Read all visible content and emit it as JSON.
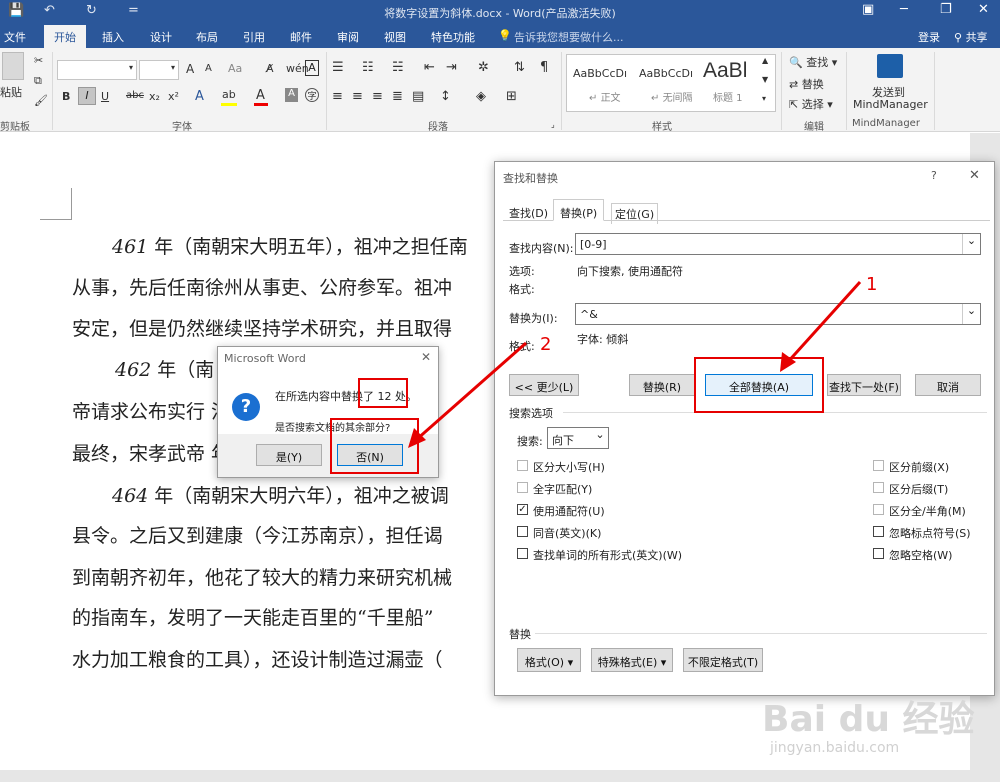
{
  "window": {
    "title": "将数字设置为斜体.docx - Word(产品激活失败)",
    "minimize": "─",
    "restore": "❐",
    "close": "✕",
    "ribbon_opts": "▣"
  },
  "quick_access": {
    "save": "💾",
    "undo": "↶",
    "redo": "↻",
    "customize": "="
  },
  "tabs": [
    "文件",
    "开始",
    "插入",
    "设计",
    "布局",
    "引用",
    "邮件",
    "审阅",
    "视图",
    "特色功能"
  ],
  "active_tab": "开始",
  "tell_me": "告诉我您想要做什么...",
  "signin": "登录",
  "share": "共享",
  "ribbon": {
    "clipboard": {
      "paste": "粘贴",
      "label": "剪贴板"
    },
    "font": {
      "label": "字体",
      "size_up": "A",
      "size_down": "A",
      "clear": "Aa",
      "bold": "B",
      "italic": "I",
      "underline": "U",
      "strike": "abc",
      "sub": "x₂",
      "sup": "x²"
    },
    "paragraph": {
      "label": "段落"
    },
    "styles": {
      "label": "样式",
      "items": [
        {
          "preview": "AaBbCcDı",
          "name": "正文"
        },
        {
          "preview": "AaBbCcDı",
          "name": "无间隔"
        },
        {
          "preview": "AaBl",
          "name": "标题 1"
        }
      ]
    },
    "editing": {
      "label": "编辑",
      "find": "查找",
      "replace": "替换",
      "select": "选择"
    },
    "mindmanager": {
      "send": "发送到",
      "name": "MindManager",
      "label": "MindManager"
    }
  },
  "document": {
    "paragraphs": [
      {
        "year": "461",
        "text": " 年（南朝宋大明五年），祖冲之担任南"
      },
      {
        "text": "从事，先后任南徐州从事吏、公府参军。祖冲"
      },
      {
        "text": "安定，但是仍然继续坚持学术研究，并且取得"
      },
      {
        "year": "462",
        "text": " 年（南                              之把精"
      },
      {
        "text": "帝请求公布实行                              法的官"
      },
      {
        "text": "最终，宋孝武帝                              年）改"
      },
      {
        "year": "464",
        "text": " 年（南朝宋大明六年），祖冲之被调"
      },
      {
        "text": "县令。之后又到建康（今江苏南京），担任谒"
      },
      {
        "text": "到南朝齐初年，他花了较大的精力来研究机械"
      },
      {
        "text": "的指南车，发明了一天能走百里的“千里船”"
      },
      {
        "text": "水力加工粮食的工具），还设计制造过漏壶（"
      }
    ]
  },
  "find_replace": {
    "title": "查找和替换",
    "help": "?",
    "close": "✕",
    "tabs": [
      "查找(D)",
      "替换(P)",
      "定位(G)"
    ],
    "find_label": "查找内容(N):",
    "find_value": "[0-9]",
    "options_label": "选项:",
    "options_value": "向下搜索, 使用通配符",
    "format_label": "格式:",
    "replace_label": "替换为(I):",
    "replace_value": "^&",
    "replace_format_label": "格式:",
    "replace_format_value": "字体: 倾斜",
    "buttons": {
      "less": "<< 更少(L)",
      "replace": "替换(R)",
      "replace_all": "全部替换(A)",
      "find_next": "查找下一处(F)",
      "cancel": "取消"
    },
    "search_options_label": "搜索选项",
    "search_label": "搜索:",
    "search_value": "向下",
    "left_options": [
      {
        "label": "区分大小写(H)",
        "checked": false,
        "disabled": true
      },
      {
        "label": "全字匹配(Y)",
        "checked": false,
        "disabled": true
      },
      {
        "label": "使用通配符(U)",
        "checked": true,
        "disabled": false
      },
      {
        "label": "同音(英文)(K)",
        "checked": false,
        "disabled": false
      },
      {
        "label": "查找单词的所有形式(英文)(W)",
        "checked": false,
        "disabled": false
      }
    ],
    "right_options": [
      {
        "label": "区分前缀(X)",
        "checked": false,
        "disabled": true
      },
      {
        "label": "区分后缀(T)",
        "checked": false,
        "disabled": true
      },
      {
        "label": "区分全/半角(M)",
        "checked": false,
        "disabled": true
      },
      {
        "label": "忽略标点符号(S)",
        "checked": false,
        "disabled": false
      },
      {
        "label": "忽略空格(W)",
        "checked": false,
        "disabled": false
      }
    ],
    "replace_section_label": "替换",
    "bottom_buttons": {
      "format": "格式(O) ▾",
      "special": "特殊格式(E) ▾",
      "no_format": "不限定格式(T)"
    }
  },
  "msgbox": {
    "title": "Microsoft Word",
    "close": "✕",
    "icon": "?",
    "line1_pre": "在所选内容中替换了 ",
    "line1_count": "12 处",
    "line1_post": "。",
    "line2": "是否搜索文档的其余部分?",
    "yes": "是(Y)",
    "no": "否(N)"
  },
  "annotations": {
    "one": "1",
    "two": "2"
  },
  "watermark": {
    "brand": "Bai du 经验",
    "url": "jingyan.baidu.com"
  }
}
